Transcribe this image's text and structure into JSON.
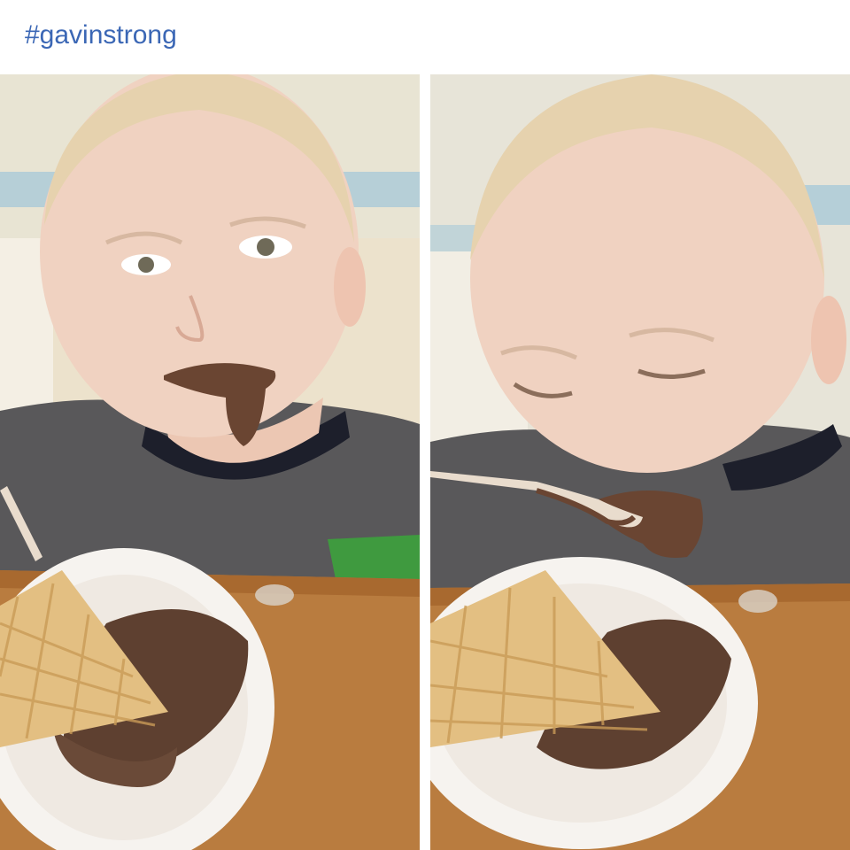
{
  "post": {
    "hashtag": "#gavinstrong"
  },
  "photos": [
    {
      "icon": "photo-boy-eating-ice-cream-looking-at-camera"
    },
    {
      "icon": "photo-boy-eating-ice-cream-from-spoon"
    }
  ],
  "colors": {
    "link": "#3b67b5",
    "wall": "#e8e4d3",
    "wall_stripe": "#a9c9d8",
    "skin": "#f0d2c1",
    "hair": "#e6d2ae",
    "shirt": "#59585a",
    "collar": "#1d1f2b",
    "chocolate": "#6a4532",
    "table": "#b97c3f",
    "plate": "#f6f3ef",
    "waffle": "#e3bf82"
  }
}
